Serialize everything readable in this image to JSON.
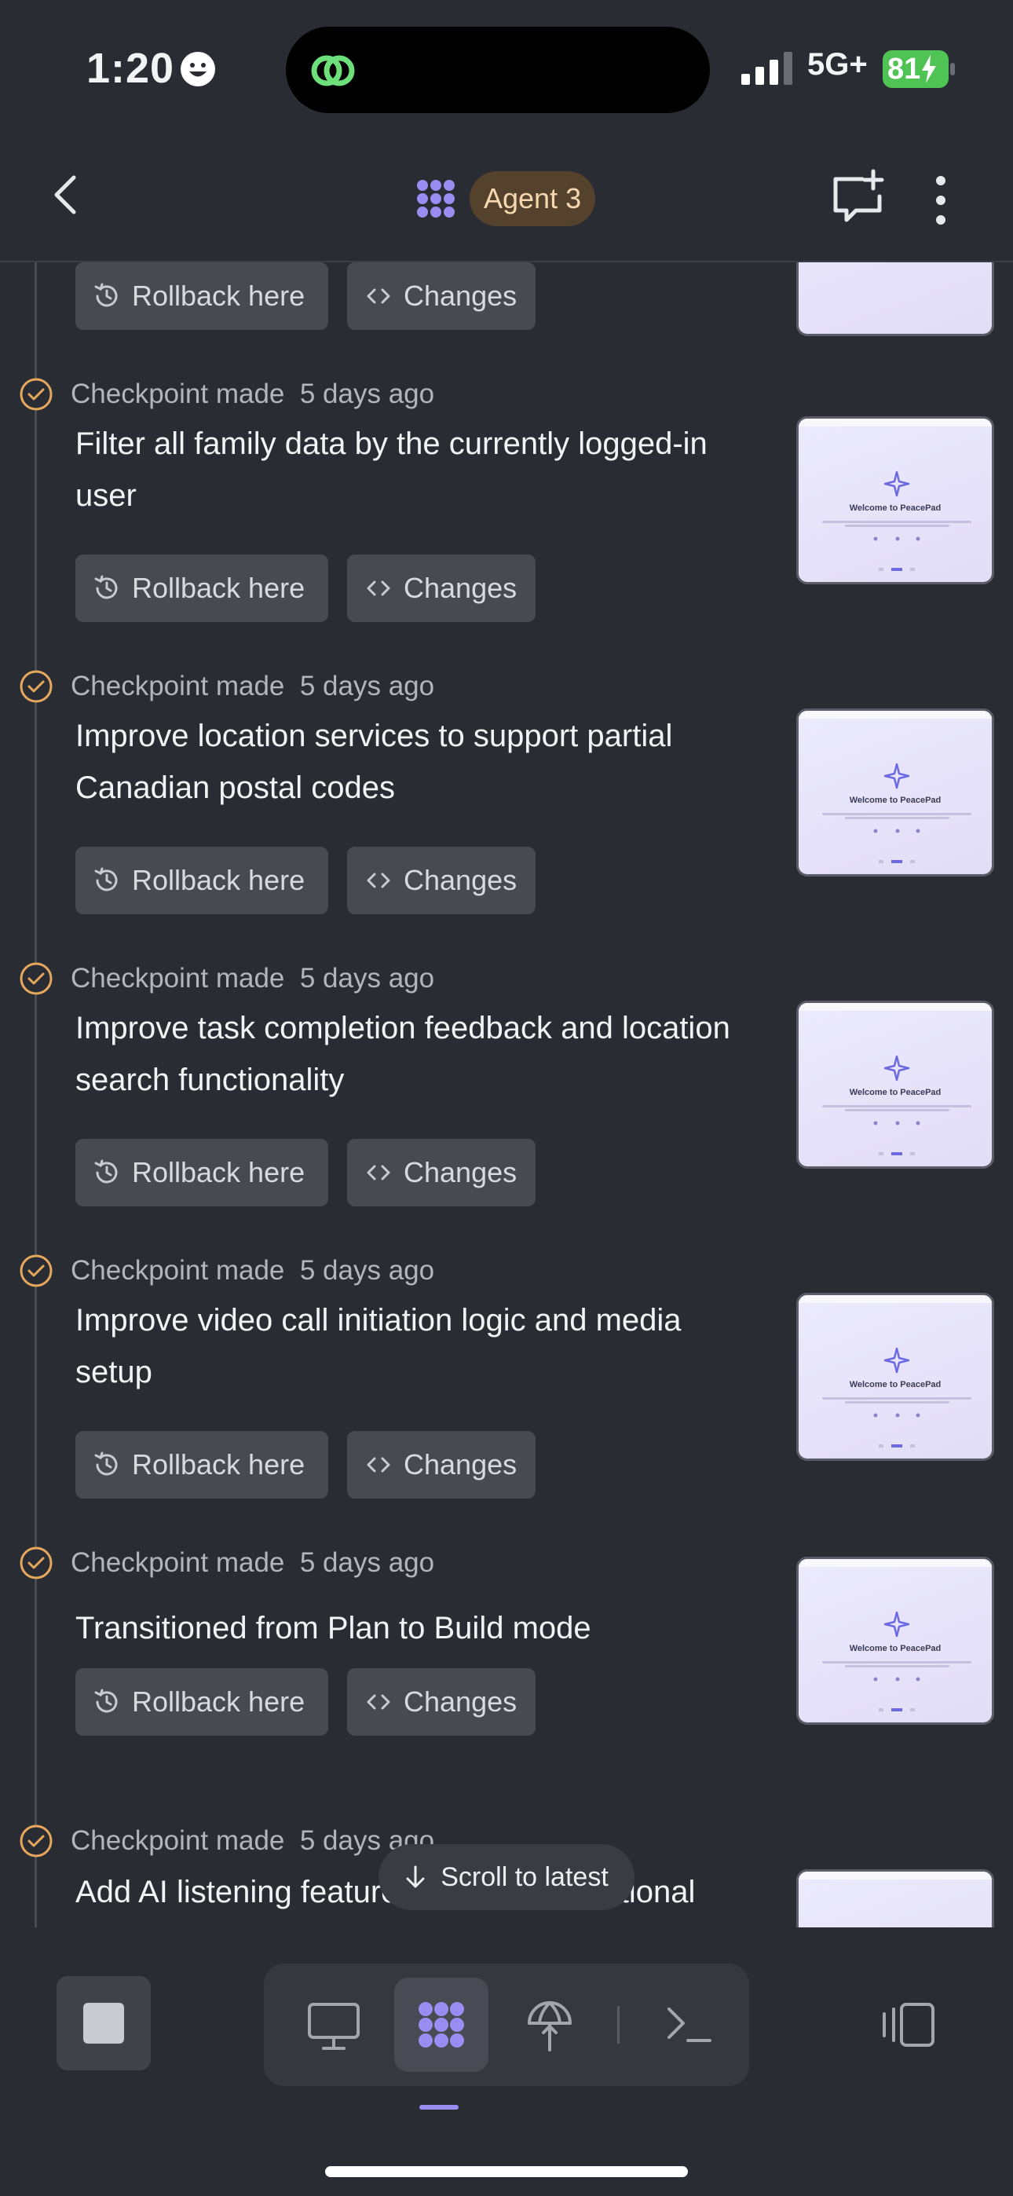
{
  "status_bar": {
    "time": "1:20",
    "network": "5G+",
    "battery": "81"
  },
  "header": {
    "agent_label": "Agent 3",
    "accent_color": "#9b8cf2"
  },
  "checkpoints": [
    {
      "meta_label": "Checkpoint made",
      "age": "5 days ago",
      "title": "Filter all family data by the currently logged-in user",
      "rollback_label": "Rollback here",
      "changes_label": "Changes",
      "thumb_title": "Welcome to PeacePad"
    },
    {
      "meta_label": "Checkpoint made",
      "age": "5 days ago",
      "title": "Improve location services to support partial Canadian postal codes",
      "rollback_label": "Rollback here",
      "changes_label": "Changes",
      "thumb_title": "Welcome to PeacePad"
    },
    {
      "meta_label": "Checkpoint made",
      "age": "5 days ago",
      "title": "Improve task completion feedback and location search functionality",
      "rollback_label": "Rollback here",
      "changes_label": "Changes",
      "thumb_title": "Welcome to PeacePad"
    },
    {
      "meta_label": "Checkpoint made",
      "age": "5 days ago",
      "title": "Improve video call initiation logic and media setup",
      "rollback_label": "Rollback here",
      "changes_label": "Changes",
      "thumb_title": "Welcome to PeacePad"
    },
    {
      "meta_label": "Checkpoint made",
      "age": "5 days ago",
      "title": "Transitioned from Plan to Build mode",
      "rollback_label": "Rollback here",
      "changes_label": "Changes",
      "thumb_title": "Welcome to PeacePad"
    },
    {
      "meta_label": "Checkpoint made",
      "age": "5 days ago",
      "title": "Add AI listening feature to analyze emotional"
    }
  ],
  "top_partial": {
    "rollback_label": "Rollback here",
    "changes_label": "Changes"
  },
  "scroll_latest_label": "Scroll to latest",
  "bottom_tabs": [
    "desktop-icon",
    "agent-icon",
    "deploy-icon",
    "terminal-icon"
  ]
}
